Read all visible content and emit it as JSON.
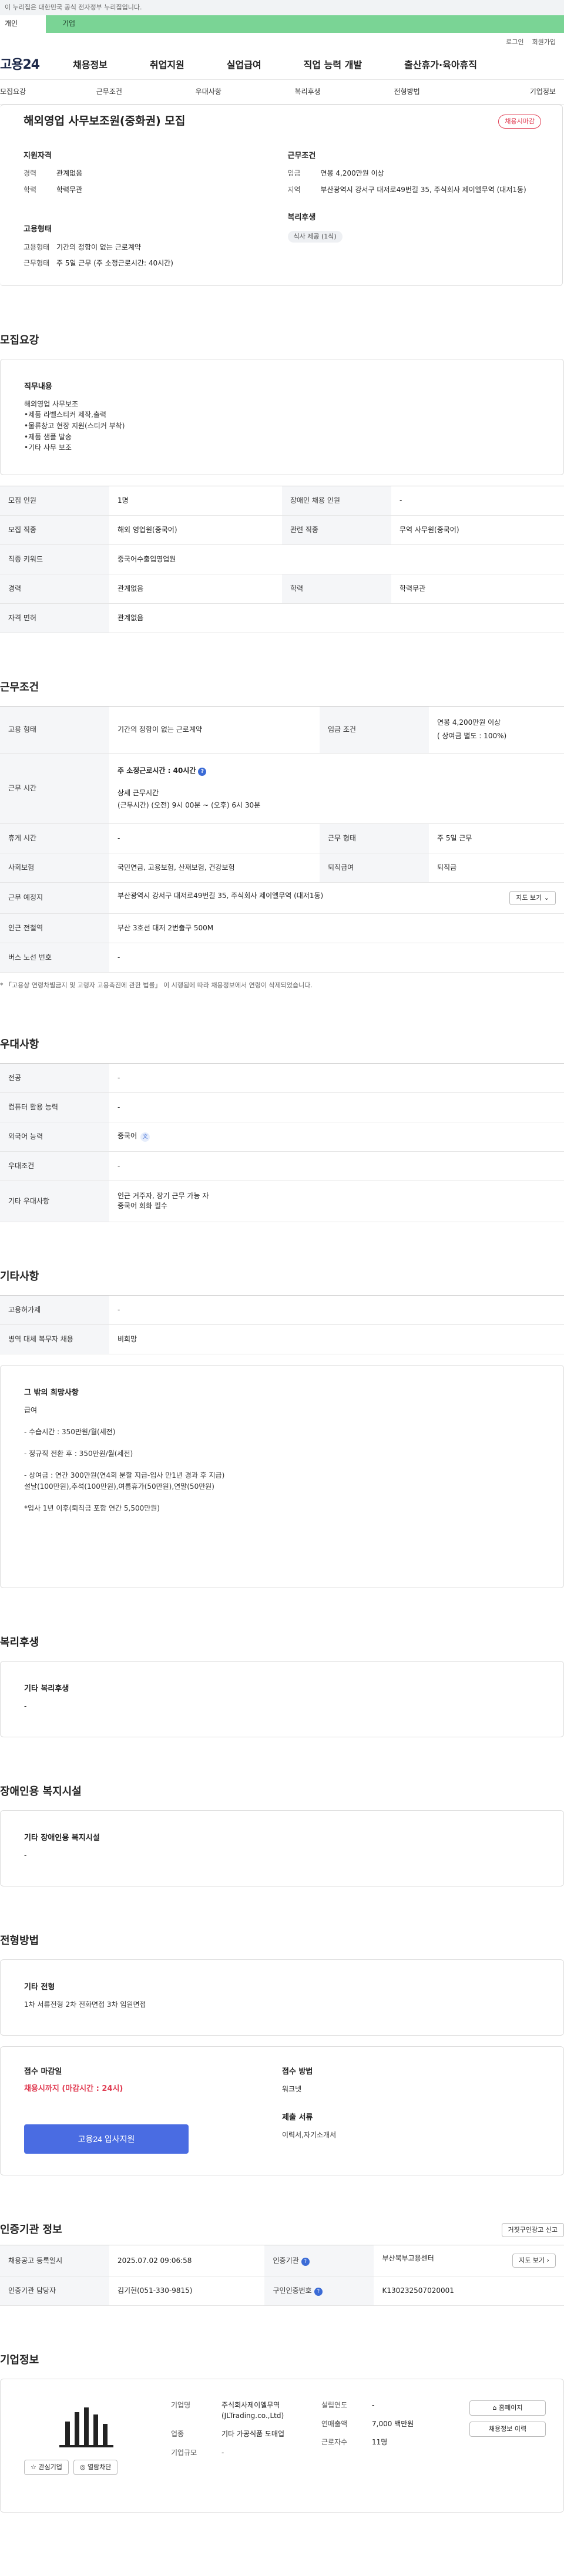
{
  "top": {
    "gov_notice": "이 누리집은 대한민국 공식 전자정부 누리집입니다.",
    "tab_person": "개인",
    "tab_company": "기업",
    "login": "로그인",
    "signup": "회원가입"
  },
  "gnb": {
    "logo": "고용24",
    "items": [
      "채용정보",
      "취업지원",
      "실업급여",
      "직업 능력 개발",
      "출산휴가·육아휴직"
    ]
  },
  "anchors": [
    "모집요강",
    "근무조건",
    "우대사항",
    "복리후생",
    "전형방법",
    "기업정보"
  ],
  "summary": {
    "title": "해외영업 사무보조원(중화권) 모집",
    "badge": "채용시마감",
    "qual_title": "지원자격",
    "career_k": "경력",
    "career_v": "관계없음",
    "edu_k": "학력",
    "edu_v": "학력무관",
    "cond_title": "근무조건",
    "pay_k": "임금",
    "pay_v": "연봉 4,200만원 이상",
    "loc_k": "지역",
    "loc_v": "부산광역시 강서구 대저로49번길 35, 주식회사 제이엘무역 (대저1동)",
    "emp_title": "고용형태",
    "emp_k": "고용형태",
    "emp_v": "기간의 정함이 없는 근로계약",
    "work_k": "근무형태",
    "work_v": "주 5일 근무 (주 소정근로시간: 40시간)",
    "welfare_title": "복리후생",
    "welfare_chip": "식사 제공 (1식)"
  },
  "recruit": {
    "title": "모집요강",
    "duty_label": "직무내용",
    "duty_text": "해외영업 사무보조\n•제품 라벨스티커 제작,출력\n•물류창고 현장 지원(스티커 부착)\n•제품 샘플 발송\n•기타 사무 보조",
    "rows": [
      [
        "모집 인원",
        "1명",
        "장애인 채용 인원",
        "-"
      ],
      [
        "모집 직종",
        "해외 영업원(중국어)",
        "관련 직종",
        "무역 사무원(중국어)"
      ],
      [
        "직종 키워드",
        "중국어수출입영업원"
      ],
      [
        "경력",
        "관계없음",
        "학력",
        "학력무관"
      ],
      [
        "자격 면허",
        "관계없음"
      ]
    ]
  },
  "work": {
    "title": "근무조건",
    "emp_k": "고용 형태",
    "emp_v": "기간의 정함이 없는 근로계약",
    "pay_k": "임금 조건",
    "pay_v1": "연봉 4,200만원 이상",
    "pay_v2": "( 상여금 별도 : 100%)",
    "time_k": "근무 시간",
    "time_main": "주 소정근로시간 : 40시간",
    "time_sub": "상세 근무시간",
    "time_detail": "(근무시간) (오전) 9시 00분 ~ (오후) 6시 30분",
    "rest_k": "휴게 시간",
    "rest_v": "-",
    "form_k": "근무 형태",
    "form_v": "주 5일 근무",
    "ins_k": "사회보험",
    "ins_v": "국민연금, 고용보험, 산재보험, 건강보험",
    "ret_k": "퇴직급여",
    "ret_v": "퇴직금",
    "place_k": "근무 예정지",
    "place_v": "부산광역시 강서구 대저로49번길 35, 주식회사 제이엘무역 (대저1동)",
    "map_btn": "지도 보기 ⌄",
    "subway_k": "인근 전철역",
    "subway_v": "부산 3호선 대저 2번출구 500M",
    "bus_k": "버스 노선 번호",
    "bus_v": "-",
    "note": "* 「고용상 연령차별금지 및 고령자 고용촉진에 관한 법률」 이 시행됨에 따라 채용정보에서 연령이 삭제되었습니다."
  },
  "pref": {
    "title": "우대사항",
    "rows": [
      [
        "전공",
        "-"
      ],
      [
        "컴퓨터 활용 능력",
        "-"
      ],
      [
        "외국어 능력",
        "중국어"
      ],
      [
        "우대조건",
        "-"
      ],
      [
        "기타 우대사항",
        "인근 거주자, 장기 근무 가능 자\n중국어 회화 필수"
      ]
    ]
  },
  "etc": {
    "title": "기타사항",
    "rows": [
      [
        "고용허가제",
        "-"
      ],
      [
        "병역 대체 복무자 채용",
        "비희망"
      ]
    ],
    "box_label": "그 밖의 희망사항",
    "box_text": "급여\n\n- 수습시간 : 350만원/월(세전)\n\n- 정규직 전환 후 : 350만원/월(세전)\n\n- 상여금 : 연간 300만원(연4회 분할 지급-입사 만1년 경과 후 지급)\n           설날(100만원),추석(100만원),여름휴가(50만원),연말(50만원)\n\n*입사 1년 이후(퇴직금 포함 연간 5,500만원)"
  },
  "welfare": {
    "title": "복리후생",
    "label": "기타 복리후생",
    "value": "-"
  },
  "disabled": {
    "title": "장애인용 복지시설",
    "label": "기타 장애인용 복지시설",
    "value": "-"
  },
  "process": {
    "title": "전형방법",
    "label": "기타 전형",
    "value": "1차 서류전형 2차 전화면접 3차 임원면접",
    "deadline_label": "접수 마감일",
    "deadline_value": "채용시까지 (마감시간 : 24시)",
    "apply_btn": "고용24 입사지원",
    "method_label": "접수 방법",
    "method_value": "워크넷",
    "docs_label": "제출 서류",
    "docs_value": "이력서,자기소개서"
  },
  "agency": {
    "title": "인증기관 정보",
    "report_btn": "거짓구인광고 신고",
    "reg_k": "채용공고 등록일시",
    "reg_v": "2025.07.02 09:06:58",
    "org_k": "인증기관",
    "org_v": "부산북부고용센터",
    "map_btn": "지도 보기 ›",
    "mgr_k": "인증기관 담당자",
    "mgr_v": "김기현(051-330-9815)",
    "num_k": "구인인증번호",
    "num_v": "K130232507020001"
  },
  "company": {
    "title": "기업정보",
    "fav_btn": "☆ 관심기업",
    "block_btn": "◎ 열람차단",
    "name_k": "기업명",
    "name_v": "주식회사제이엘무역(JLTrading.co.,Ltd)",
    "year_k": "설립연도",
    "year_v": "-",
    "biz_k": "업종",
    "biz_v": "기타 가공식품 도매업",
    "sales_k": "연매출액",
    "sales_v": "7,000 백만원",
    "emp_k": "근로자수",
    "emp_v": "11명",
    "size_k": "기업규모",
    "size_v": "-",
    "home_btn": "⌂ 홈페이지",
    "other_btn": "채용정보 이력"
  }
}
